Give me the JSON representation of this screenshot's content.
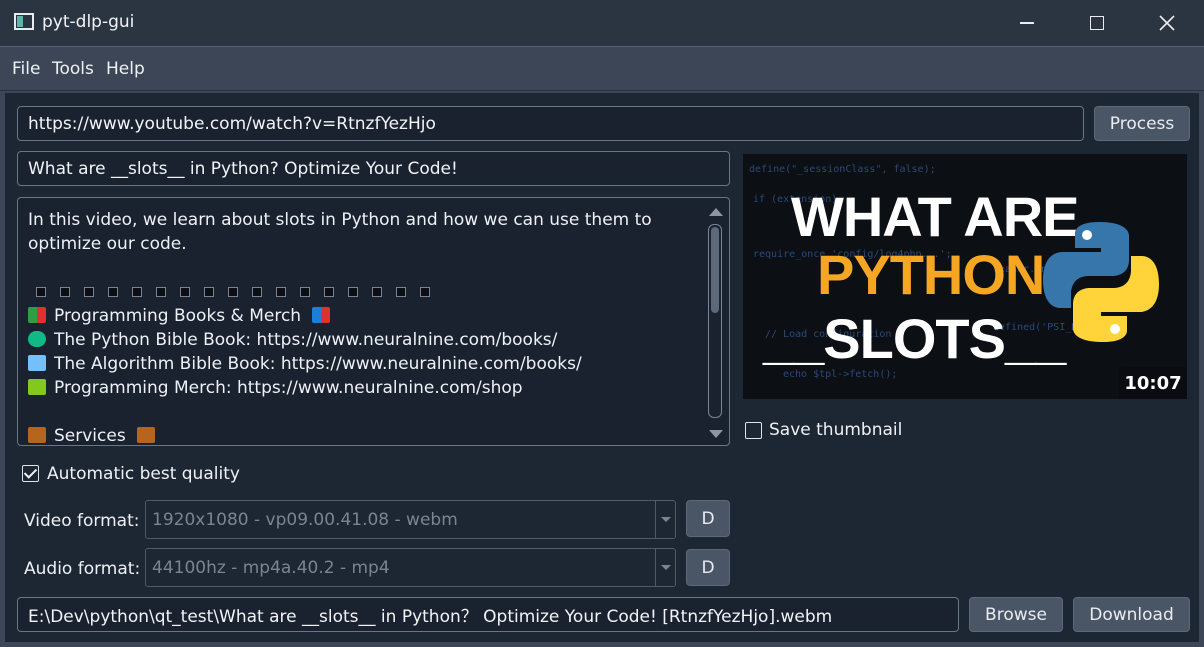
{
  "window": {
    "title": "pyt-dlp-gui"
  },
  "menu": {
    "items": [
      "File",
      "Tools",
      "Help"
    ]
  },
  "url": {
    "value": "https://www.youtube.com/watch?v=RtnzfYezHjo",
    "process_label": "Process"
  },
  "video": {
    "title": "What are __slots__ in Python? Optimize Your Code!",
    "description": {
      "intro": "In this video, we learn about slots in Python and how we can use them to optimize our code.",
      "lines": [
        "Programming Books & Merch",
        "The Python Bible Book: https://www.neuralnine.com/books/",
        "The Algorithm Bible Book: https://www.neuralnine.com/books/",
        "Programming Merch: https://www.neuralnine.com/shop",
        "Services"
      ]
    },
    "thumbnail": {
      "line1": "WHAT ARE",
      "line2": "PYTHON",
      "line3": "__SLOTS__",
      "duration": "10:07"
    }
  },
  "save_thumbnail": {
    "label": "Save thumbnail",
    "checked": false
  },
  "auto_quality": {
    "label": "Automatic best quality",
    "checked": true
  },
  "video_format": {
    "label": "Video format:",
    "value": "1920x1080 - vp09.00.41.08 - webm",
    "button": "D"
  },
  "audio_format": {
    "label": "Audio format:",
    "value": "44100hz - mp4a.40.2 - mp4",
    "button": "D"
  },
  "output": {
    "path": "E:\\Dev\\python\\qt_test\\What are __slots__ in Python？ Optimize Your Code! [RtnzfYezHjo].webm",
    "browse_label": "Browse",
    "download_label": "Download"
  },
  "colors": {
    "accent_orange": "#f5a623",
    "content_bg": "#1d2633",
    "chrome_bg": "#3c4656"
  },
  "icons": [
    "app-icon",
    "minimize-icon",
    "maximize-icon",
    "close-icon",
    "books-icon",
    "python-icon",
    "laptop-icon",
    "shirt-icon",
    "briefcase-icon"
  ]
}
